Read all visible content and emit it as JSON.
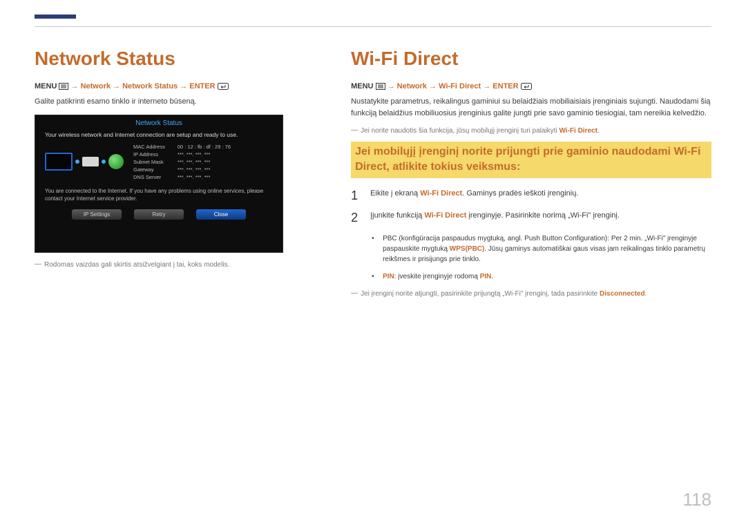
{
  "page_number": "118",
  "left": {
    "heading": "Network Status",
    "menu_prefix": "MENU",
    "menu_path": " → Network → Network Status → ENTER",
    "desc": "Galite patikrinti esamo tinklo ir interneto būseną.",
    "note": "Rodomas vaizdas gali skirtis atsižvelgiant į tai, koks modelis.",
    "shot": {
      "title": "Network Status",
      "msg": "Your wireless network and Internet connection are setup and ready to use.",
      "labels": {
        "mac": "MAC Address",
        "ip": "IP Address",
        "subnet": "Subnet Mask",
        "gateway": "Gateway",
        "dns": "DNS Server"
      },
      "values": {
        "mac": "00 : 12 : fb : df : 29 : 76",
        "ip": "***. ***. ***. ***",
        "subnet": "***. ***. ***. ***",
        "gateway": "***. ***. ***. ***",
        "dns": "***. ***. ***. ***"
      },
      "footer_msg": "You are connected to the Internet. If you have any problems using online services, please contact your Internet service provider.",
      "buttons": {
        "ipsettings": "IP Settings",
        "retry": "Retry",
        "close": "Close"
      }
    }
  },
  "right": {
    "heading": "Wi-Fi Direct",
    "menu_prefix": "MENU",
    "menu_path": " → Network → Wi-Fi Direct → ENTER",
    "desc": "Nustatykite parametrus, reikalingus gaminiui su belaidžiais mobiliaisiais įrenginiais sujungti. Naudodami šią funkciją belaidžius mobiliuosius įrenginius galite jungti prie savo gaminio tiesiogiai, tam nereikia kelvedžio.",
    "note1_a": "Jei norite naudotis šia funkcija, jūsų mobilųjį įrenginį turi palaikyti ",
    "note1_b": "Wi-Fi Direct",
    "note1_c": ".",
    "highlight": "Jei mobilųjį įrenginį norite prijungti prie gaminio naudodami Wi-Fi Direct, atlikite tokius veiksmus:",
    "step1_a": "Eikite į ekraną ",
    "step1_b": "Wi-Fi Direct",
    "step1_c": ". Gaminys pradės ieškoti įrenginių.",
    "step2_a": "Įjunkite funkciją ",
    "step2_b": "Wi-Fi Direct",
    "step2_c": " įrenginyje. Pasirinkite norimą „Wi-Fi\" įrenginį.",
    "bullet1_a": "PBC (konfigūracija paspaudus mygtuką, angl. Push Button Configuration): Per 2 min. „Wi-Fi\" įrenginyje paspauskite mygtuką ",
    "bullet1_b": "WPS(PBC)",
    "bullet1_c": ". Jūsų gaminys automatiškai gaus visas jam reikalingas tinklo parametrų reikšmes ir prisijungs prie tinklo.",
    "bullet2_a": "PIN",
    "bullet2_b": ": įveskite įrenginyje rodomą ",
    "bullet2_c": "PIN",
    "bullet2_d": ".",
    "note2_a": "Jei įrenginį norite atjungti, pasirinkite prijungtą „Wi-Fi\" įrenginį, tada pasirinkite ",
    "note2_b": "Disconnected",
    "note2_c": "."
  }
}
